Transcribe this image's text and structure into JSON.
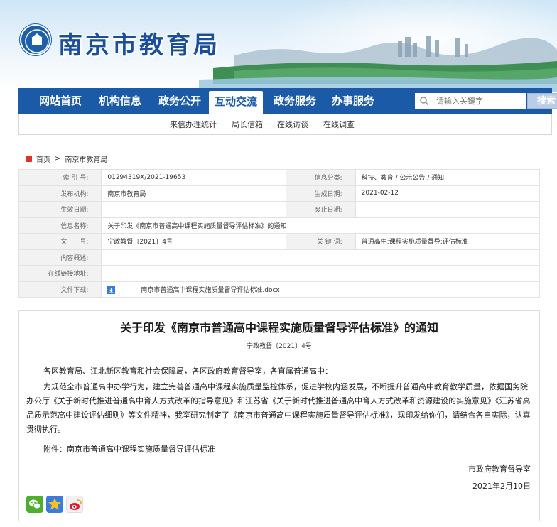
{
  "header": {
    "site_title": "南京市教育局"
  },
  "nav": {
    "items": [
      {
        "label": "网站首页"
      },
      {
        "label": "机构信息"
      },
      {
        "label": "政务公开"
      },
      {
        "label": "互动交流",
        "active": true
      },
      {
        "label": "政务服务"
      },
      {
        "label": "办事服务"
      }
    ],
    "search_placeholder": "请输入关键字",
    "search_button": "搜索"
  },
  "subnav": {
    "items": [
      {
        "label": "来信办理统计"
      },
      {
        "label": "局长信箱"
      },
      {
        "label": "在线访谈"
      },
      {
        "label": "在线调查"
      }
    ]
  },
  "breadcrumb": {
    "home": "首页",
    "separator": ">",
    "current": "南京市教育局"
  },
  "info": {
    "index_no_label": "索 引 号:",
    "index_no": "01294319X/2021-19653",
    "category_label": "信息分类:",
    "category": "科技、教育 / 公示公告 / 通知",
    "publisher_label": "发布机构:",
    "publisher": "南京市教育局",
    "created_label": "生成日期:",
    "created": "2021-02-12",
    "effective_label": "生效日期:",
    "effective": "",
    "repeal_label": "废止日期:",
    "repeal": "",
    "name_label": "信息名称:",
    "name": "关于印发《南京市普通高中课程实施质量督导评估标准》的通知",
    "doc_label": "文　　号:",
    "doc_no": "宁政教督〔2021〕4号",
    "keywords_label": "关 键 词:",
    "keywords": "普通高中;课程实施质量督导;评估标准",
    "summary_label": "内容概述:",
    "summary": "",
    "link_label": "在线链接地址:",
    "link": "",
    "download_label": "文件下载:",
    "download_file": "南京市普通高中课程实施质量督导评估标准.docx"
  },
  "article": {
    "title": "关于印发《南京市普通高中课程实施质量督导评估标准》的通知",
    "doc_no": "宁政教督〔2021〕4号",
    "salutation": "各区教育局、江北新区教育和社会保障局，各区政府教育督导室，各直属普通高中：",
    "body": "为规范全市普通高中办学行为，建立完善普通高中课程实施质量监控体系，促进学校内涵发展，不断提升普通高中教育教学质量，依据国务院办公厅《关于新时代推进普通高中育人方式改革的指导意见》和江苏省《关于新时代推进普通高中育人方式改革和资源建设的实施意见》《江苏省高品质示范高中建设评估细则》等文件精神，我室研究制定了《南京市普通高中课程实施质量督导评估标准》，现印发给你们，请结合各自实际，认真贯彻执行。",
    "attachment": "附件：南京市普通高中课程实施质量督导评估标准",
    "signer": "市政府教育督导室",
    "date": "2021年2月10日"
  },
  "colors": {
    "brand_blue": "#1b5aa6",
    "title_blue": "#1b4f9c"
  },
  "share": {
    "icons": [
      "wechat-icon",
      "qzone-icon",
      "weibo-icon"
    ]
  }
}
